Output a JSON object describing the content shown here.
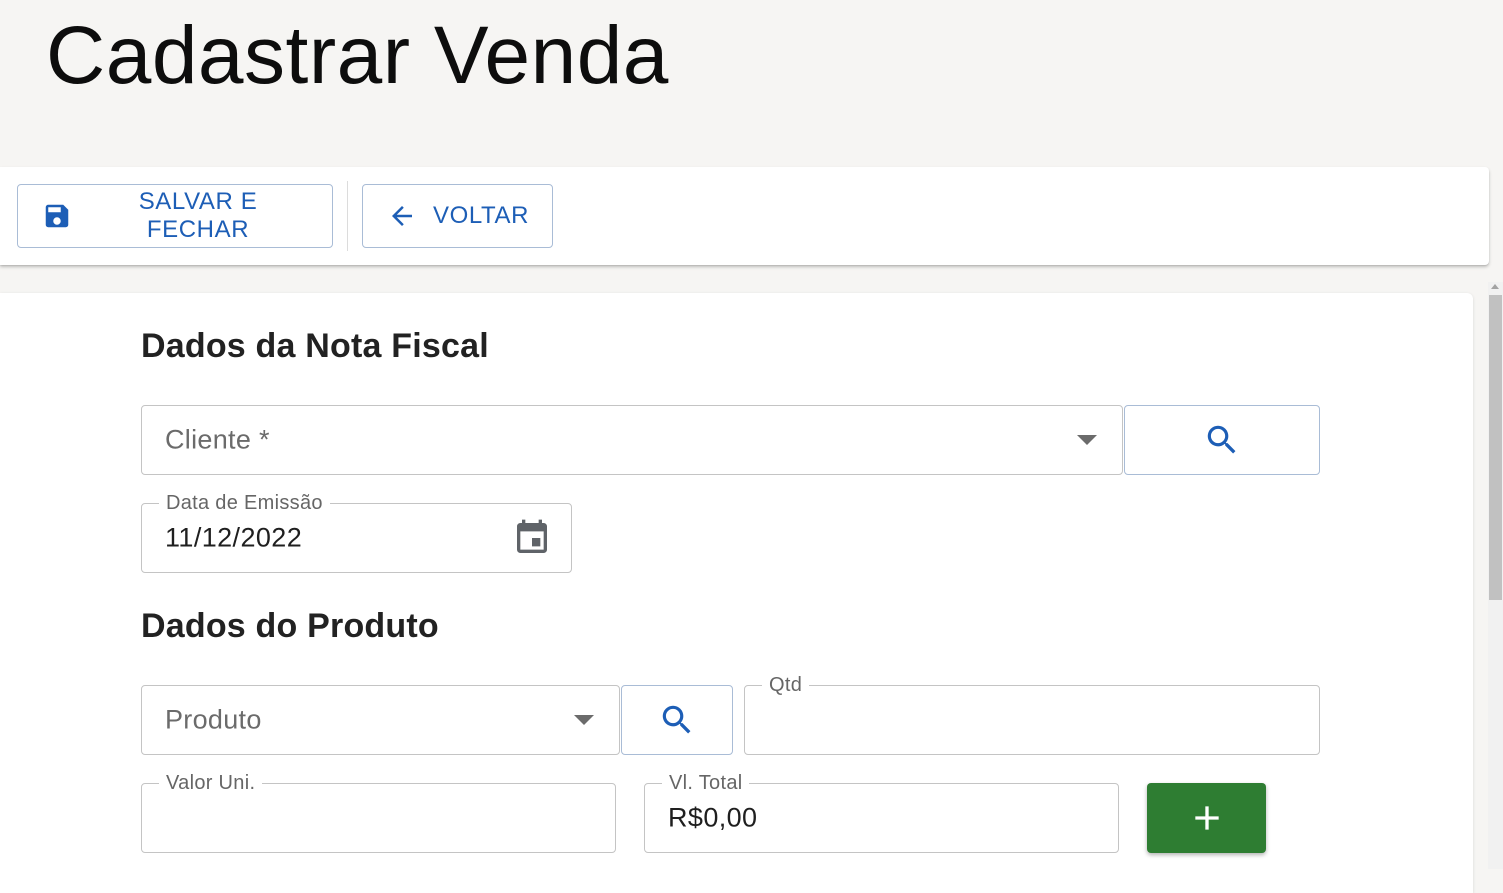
{
  "page": {
    "title": "Cadastrar Venda"
  },
  "toolbar": {
    "save_label": "SALVAR E FECHAR",
    "back_label": "VOLTAR"
  },
  "nota_fiscal": {
    "section_title": "Dados da Nota Fiscal",
    "cliente": {
      "placeholder": "Cliente *",
      "value": ""
    },
    "data_emissao": {
      "label": "Data de Emissão",
      "value": "11/12/2022"
    }
  },
  "produto": {
    "section_title": "Dados do Produto",
    "produto": {
      "placeholder": "Produto",
      "value": ""
    },
    "qtd": {
      "label": "Qtd",
      "value": ""
    },
    "valor_uni": {
      "label": "Valor Uni.",
      "value": ""
    },
    "vl_total": {
      "label": "Vl. Total",
      "value": "R$0,00"
    }
  },
  "colors": {
    "primary": "#1d5eb6",
    "success": "#2e7d32",
    "background": "#f6f5f3"
  },
  "icons": {
    "save": "save-icon",
    "back": "arrow-left-icon",
    "search": "search-icon",
    "calendar": "calendar-icon",
    "dropdown": "chevron-down-icon",
    "add": "plus-icon"
  }
}
